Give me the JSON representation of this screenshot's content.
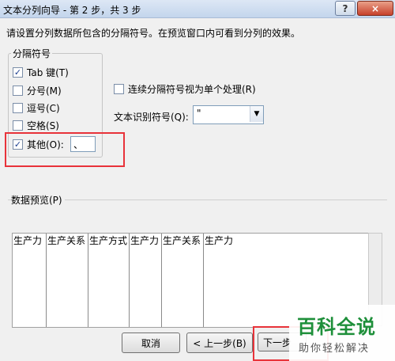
{
  "window": {
    "title": "文本分列向导 - 第 2 步，共 3 步",
    "help_glyph": "?",
    "close_glyph": "×"
  },
  "instruction": "请设置分列数据所包含的分隔符号。在预览窗口内可看到分列的效果。",
  "delimiters": {
    "group_label": "分隔符号",
    "tab": {
      "label": "Tab 键(T)",
      "checked": true
    },
    "semicolon": {
      "label": "分号(M)",
      "checked": false
    },
    "comma": {
      "label": "逗号(C)",
      "checked": false
    },
    "space": {
      "label": "空格(S)",
      "checked": false
    },
    "other": {
      "label": "其他(O):",
      "checked": true,
      "value": "、"
    }
  },
  "consecutive": {
    "label": "连续分隔符号视为单个处理(R)",
    "checked": false
  },
  "qualifier": {
    "label": "文本识别符号(Q):",
    "value": "\""
  },
  "preview": {
    "label": "数据预览(P)",
    "columns": [
      "生产力",
      "生产关系",
      "生产方式",
      "生产力",
      "生产关系",
      "生产力"
    ]
  },
  "buttons": {
    "cancel": "取消",
    "back": "< 上一步(B)",
    "next": "下一步"
  },
  "watermark": {
    "main": "百科全说",
    "sub": "助你轻松解决"
  },
  "icons": {
    "check": "check-icon",
    "dropdown": "chevron-down-icon"
  },
  "colors": {
    "highlight": "#e8333a",
    "watermark_green": "#1e8f3a"
  }
}
